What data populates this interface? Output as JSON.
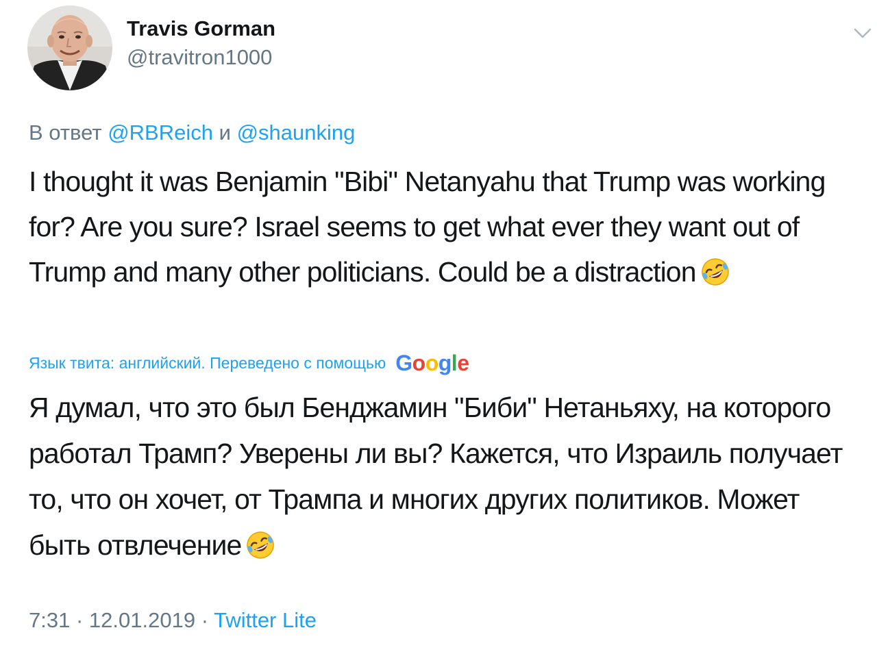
{
  "author": {
    "name": "Travis Gorman",
    "handle": "@travitron1000"
  },
  "reply": {
    "prefix": "В ответ",
    "user1": "@RBReich",
    "conjunction": "и",
    "user2": "@shaunking"
  },
  "tweet": {
    "text": "I thought it was Benjamin \"Bibi\" Netanyahu that Trump was working for?  Are you sure? Israel seems to get what ever they want out of Trump and many other politicians. Could be a distraction",
    "emoji": "rolling-on-floor-laughing-emoji"
  },
  "translation": {
    "label": "Язык твита: английский. Переведено с помощью",
    "provider": "Google",
    "text": "Я думал, что это был Бенджамин \"Биби\" Нетаньяху, на которого работал Трамп? Уверены ли вы? Кажется, что Израиль получает то, что он хочет, от Трампа и многих других политиков. Может быть отвлечение",
    "emoji": "rolling-on-floor-laughing-emoji"
  },
  "meta": {
    "time": "7:31",
    "separator": "·",
    "date": "12.01.2019",
    "source": "Twitter Lite"
  },
  "colors": {
    "accent": "#1da1f2",
    "secondary": "#657786",
    "text": "#14171a"
  }
}
